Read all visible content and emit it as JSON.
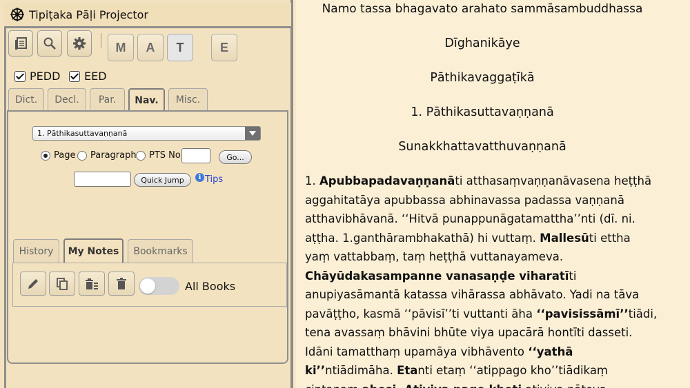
{
  "window": {
    "title": "Tipiṭaka Pāḷi Projector"
  },
  "toolbar": {
    "icons": [
      "books-icon",
      "search-icon",
      "gear-icon"
    ],
    "letters": [
      "M",
      "A",
      "T",
      "E"
    ],
    "active_letter": "T"
  },
  "dictionaries": [
    {
      "label": "PEDD",
      "checked": true
    },
    {
      "label": "EED",
      "checked": true
    }
  ],
  "tabs": [
    "Dict.",
    "Decl.",
    "Par.",
    "Nav.",
    "Misc."
  ],
  "active_tab": "Nav.",
  "nav": {
    "book_select": "1. Pāthikasuttavaṇṇanā",
    "radios": [
      "Page",
      "Paragraph",
      "PTS No"
    ],
    "selected_radio": "Page",
    "go_label": "Go...",
    "quick_jump_label": "Quick Jump",
    "tips_label": "Tips"
  },
  "subtabs": [
    "History",
    "My Notes",
    "Bookmarks"
  ],
  "active_subtab": "My Notes",
  "notes": {
    "icons": [
      "edit-icon",
      "copy-icon",
      "delete-list-icon",
      "trash-icon"
    ],
    "toggle_on": false,
    "toggle_label": "All Books"
  },
  "reader": {
    "invocation": "Namo tassa bhagavato arahato sammāsambuddhassa",
    "nikaya": "Dīghanikāye",
    "vagga": "Pāthikavaggaṭīkā",
    "sutta": "1. Pāthikasuttavaṇṇanā",
    "section": "Sunakkhattavatthuvaṇṇanā",
    "lines": [
      [
        "1. ",
        "Apubbapadavaṇṇanā",
        "ti atthasaṃvaṇṇanāvasena heṭṭhā"
      ],
      [
        "aggahitatāya apubbassa abhinavassa padassa vaṇṇanā"
      ],
      [
        "atthavibhāvanā. ‘‘Hitvā punappunāgatamattha’’nti (dī. ni."
      ],
      [
        "aṭṭha. 1.ganthārambhakathā) hi vuttaṃ. ",
        "Mallesū",
        "ti ettha"
      ],
      [
        "yaṃ vattabbaṃ, taṃ heṭṭhā vuttanayameva."
      ],
      [
        "",
        "Chāyūdakasampanne vanasaṇḍe viharatī",
        "ti"
      ],
      [
        "anupiyasāmantā katassa vihārassa abhāvato. Yadi na tāva"
      ],
      [
        "pavāṭṭho, kasmā ‘‘pāvisī’’ti vuttanti āha ",
        "‘‘pavisissāmī’’",
        "tiādi,"
      ],
      [
        "tena avassaṃ bhāvini bhūte viya upacārā hontīti dasseti."
      ],
      [
        "Idāni tamatthaṃ upamāya vibhāvento ",
        "‘‘yathā",
        ""
      ],
      [
        "",
        "ki’’",
        "ntiādimāha. ",
        "Eta",
        "nti etaṃ ‘‘atippago kho’’tiādikaṃ"
      ],
      [
        "cintanaṃ ",
        "ahosi. Atiyiva pago khoti",
        " atiyiva pātova"
      ]
    ]
  }
}
